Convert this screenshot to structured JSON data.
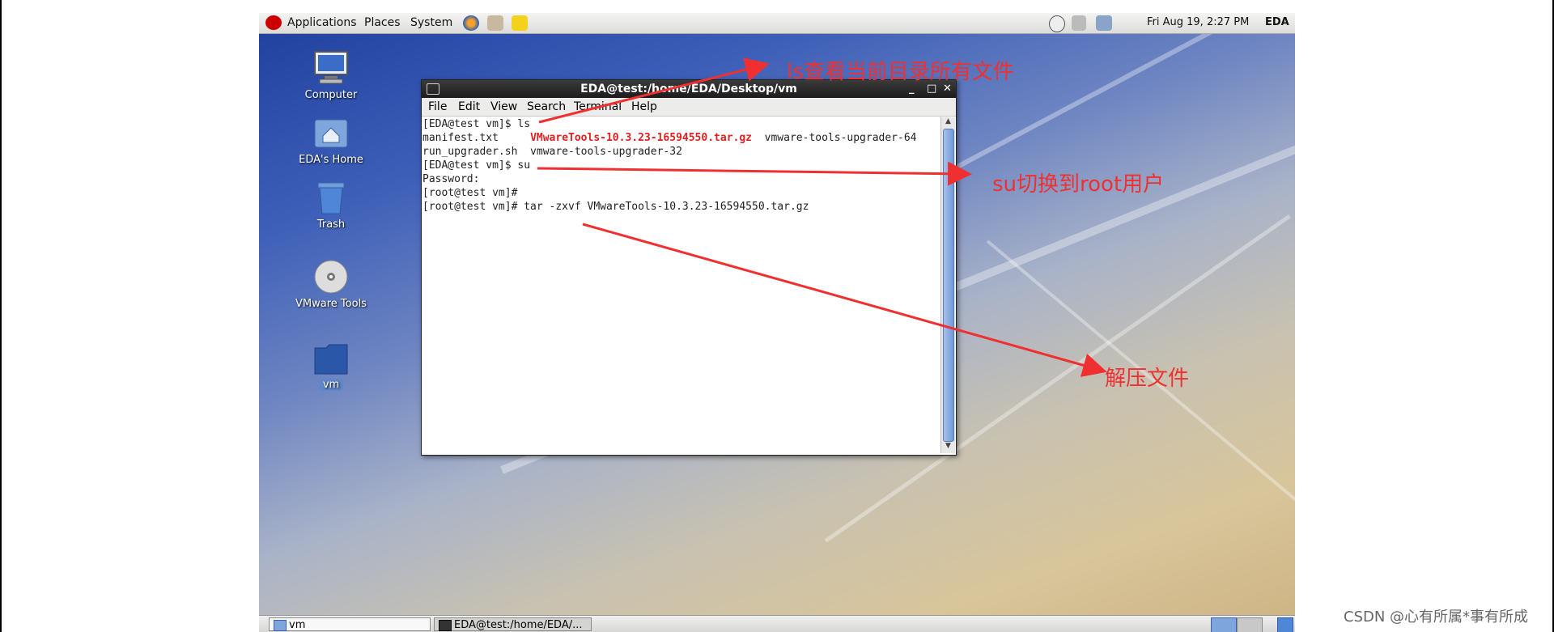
{
  "topbar": {
    "menus": [
      "Applications",
      "Places",
      "System"
    ],
    "datetime": "Fri Aug 19,  2:27 PM",
    "user": "EDA"
  },
  "desktop": {
    "icons": [
      {
        "label": "Computer"
      },
      {
        "label": "EDA's Home"
      },
      {
        "label": "Trash"
      },
      {
        "label": "VMware Tools"
      },
      {
        "label": "vm"
      }
    ]
  },
  "terminal": {
    "title": "EDA@test:/home/EDA/Desktop/vm",
    "controls": [
      "_",
      "□",
      "✕"
    ],
    "menu": [
      "File",
      "Edit",
      "View",
      "Search",
      "Terminal",
      "Help"
    ],
    "lines": {
      "l1": "[EDA@test vm]$ ls",
      "l2a": "manifest.txt     ",
      "l2b": "VMwareTools-10.3.23-16594550.tar.gz",
      "l2c": "  vmware-tools-upgrader-64",
      "l3": "run_upgrader.sh  vmware-tools-upgrader-32",
      "l4": "[EDA@test vm]$ su",
      "l5": "Password:",
      "l6": "[root@test vm]#",
      "l7": "[root@test vm]# tar -zxvf VMwareTools-10.3.23-16594550.tar.gz"
    }
  },
  "taskbar": {
    "tasks": [
      "vm",
      "EDA@test:/home/EDA/..."
    ]
  },
  "annotations": {
    "a1": "ls查看当前目录所有文件",
    "a2": "su切换到root用户",
    "a3": "解压文件"
  },
  "watermark": "CSDN @心有所属*事有所成",
  "colors": {
    "annotation": "#f03030",
    "highlight_file": "#e02020"
  }
}
